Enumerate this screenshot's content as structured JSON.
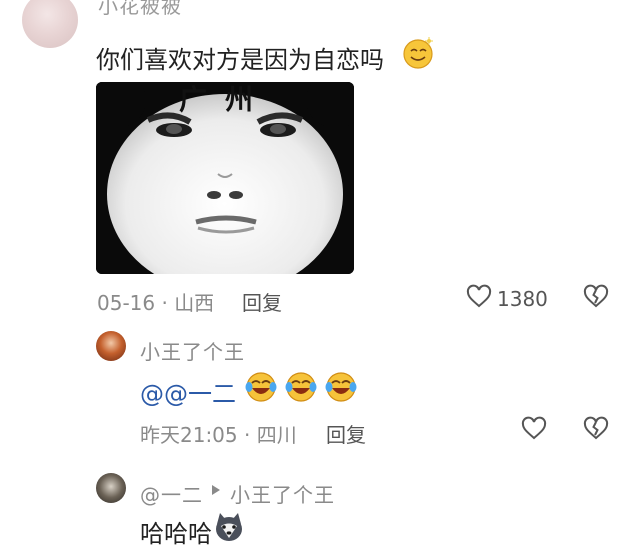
{
  "top_comment": {
    "username_partial": "小花被被",
    "text": "你们喜欢对方是因为自恋吗",
    "trailing_emoji": "smile-emoji",
    "image_caption": "广州",
    "meta": {
      "date": "05-16 · 山西",
      "reply_label": "回复",
      "like_count": "1380"
    }
  },
  "reply_1": {
    "username": "小王了个王",
    "text": "@@一二",
    "emojis": [
      "crying-laughing-emoji",
      "crying-laughing-emoji",
      "crying-laughing-emoji"
    ],
    "meta": {
      "date": "昨天21:05 · 四川",
      "reply_label": "回复"
    }
  },
  "reply_2": {
    "username": "@一二",
    "reply_to": "小王了个王",
    "text": "哈哈哈",
    "emoji": "husky-emoji"
  },
  "colors": {
    "mention_blue": "#2b5aa8",
    "meta_gray": "#8a8a8a",
    "icon_gray": "#555555"
  }
}
